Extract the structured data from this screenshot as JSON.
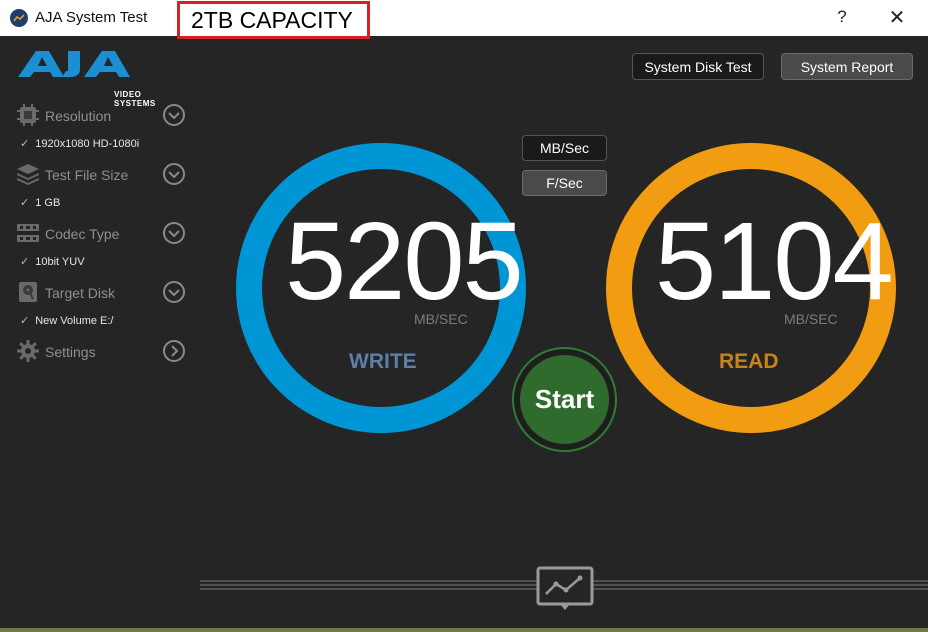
{
  "window": {
    "title": "AJA System Test",
    "annotation": "2TB CAPACITY",
    "help": "?",
    "close": "✕"
  },
  "logo": {
    "subtitle": "VIDEO SYSTEMS"
  },
  "sidebar": {
    "items": [
      {
        "label": "Resolution",
        "value": "1920x1080 HD-1080i",
        "icon": "resolution-icon"
      },
      {
        "label": "Test File Size",
        "value": "1 GB",
        "icon": "file-size-icon"
      },
      {
        "label": "Codec Type",
        "value": "10bit YUV",
        "icon": "codec-icon"
      },
      {
        "label": "Target Disk",
        "value": "New Volume E:/",
        "icon": "disk-icon"
      },
      {
        "label": "Settings",
        "icon": "gear-icon"
      }
    ],
    "check": "✓"
  },
  "toolbar": {
    "system_disk_test": "System Disk Test",
    "system_report": "System Report"
  },
  "units": {
    "mbsec": "MB/Sec",
    "fsec": "F/Sec"
  },
  "write": {
    "value": "5205",
    "unit": "MB/SEC",
    "label": "WRITE",
    "color": "#0096d6"
  },
  "read": {
    "value": "5104",
    "unit": "MB/SEC",
    "label": "READ",
    "color": "#f29c11"
  },
  "start": {
    "label": "Start"
  }
}
